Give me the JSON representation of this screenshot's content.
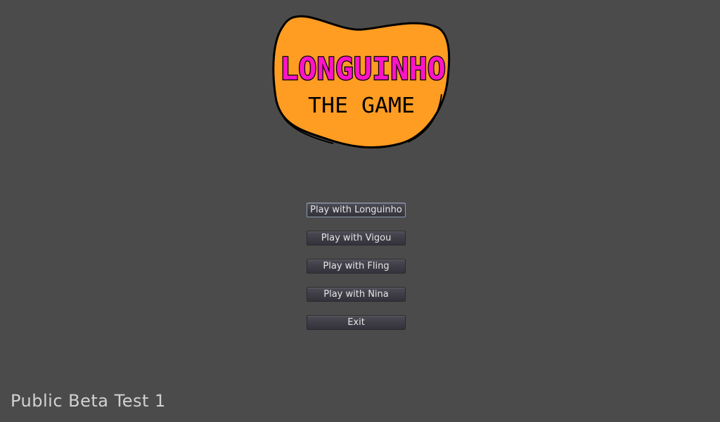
{
  "logo": {
    "title": "LONGUINHO",
    "subtitle": "THE GAME",
    "fill_color": "#ff9c22",
    "title_color": "#ff14c8",
    "outline_color": "#000000"
  },
  "menu": {
    "buttons": [
      {
        "label": "Play with Longuinho",
        "focused": true
      },
      {
        "label": "Play with Vigou"
      },
      {
        "label": "Play with Fling"
      },
      {
        "label": "Play with Nina"
      },
      {
        "label": "Exit"
      }
    ]
  },
  "footer": {
    "version_text": "Public Beta Test 1"
  },
  "colors": {
    "background": "#4b4b4b",
    "button_face": "#3d3c45",
    "button_text": "#e6e6e6",
    "focus_border": "#8c9bb0"
  }
}
